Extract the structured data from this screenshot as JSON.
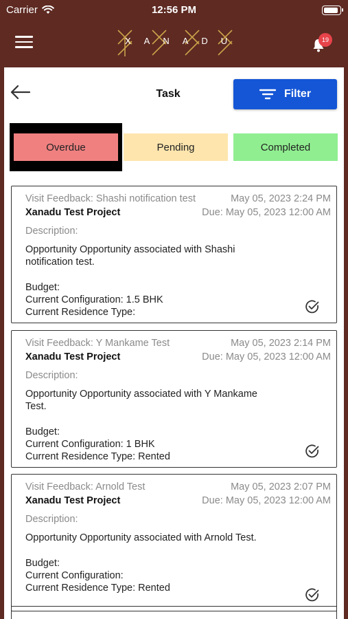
{
  "status": {
    "carrier": "Carrier",
    "time": "12:56 PM"
  },
  "header": {
    "logo_text": "XANADU",
    "notification_count": "19"
  },
  "page": {
    "title": "Task",
    "filter_label": "Filter"
  },
  "tabs": [
    {
      "label": "Overdue",
      "color": "#f08080",
      "selected": true
    },
    {
      "label": "Pending",
      "color": "#fde5ad"
    },
    {
      "label": "Completed",
      "color": "#90ee90"
    }
  ],
  "cards": [
    {
      "title": "Visit Feedback: Shashi notification test",
      "datetime": "May 05, 2023 2:24 PM",
      "project": "Xanadu Test Project",
      "due": "Due: May 05, 2023 12:00 AM",
      "description_label": "Description:",
      "description_line1": "Opportunity Opportunity associated with Shashi",
      "description_line2": "notification test.",
      "budget": "Budget:",
      "configuration": "Current Configuration: 1.5 BHK",
      "residence": "Current Residence Type:"
    },
    {
      "title": "Visit Feedback: Y Mankame Test",
      "datetime": "May 05, 2023 2:14 PM",
      "project": "Xanadu Test Project",
      "due": "Due: May 05, 2023 12:00 AM",
      "description_label": "Description:",
      "description_line1": "Opportunity Opportunity associated with Y Mankame",
      "description_line2": "Test.",
      "budget": "Budget:",
      "configuration": "Current Configuration: 1 BHK",
      "residence": "Current Residence Type: Rented"
    },
    {
      "title": "Visit Feedback: Arnold Test",
      "datetime": "May 05, 2023 2:07 PM",
      "project": "Xanadu Test Project",
      "due": "Due: May 05, 2023 12:00 AM",
      "description_label": "Description:",
      "description_line1": "Opportunity Opportunity associated with Arnold Test.",
      "description_line2": "",
      "budget": "Budget:",
      "configuration": "Current Configuration:",
      "residence": "Current Residence Type: Rented"
    }
  ]
}
